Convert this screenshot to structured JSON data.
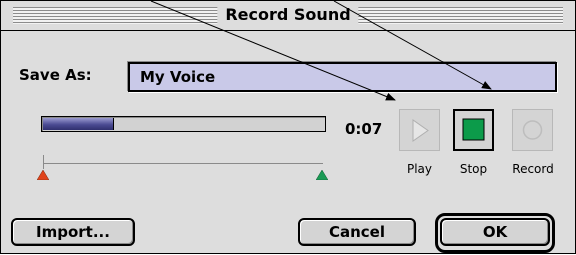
{
  "dialog": {
    "title": "Record Sound"
  },
  "save_as": {
    "label": "Save As:",
    "value": "My Voice"
  },
  "recording": {
    "progress_fraction": 0.25,
    "elapsed_time": "0:07"
  },
  "transport": {
    "play_label": "Play",
    "stop_label": "Stop",
    "record_label": "Record",
    "active": "stop",
    "stop_color": "#0c9b4a",
    "start_marker_color": "#e0441c",
    "end_marker_color": "#1a9a55"
  },
  "buttons": {
    "import_label": "Import...",
    "cancel_label": "Cancel",
    "ok_label": "OK"
  }
}
